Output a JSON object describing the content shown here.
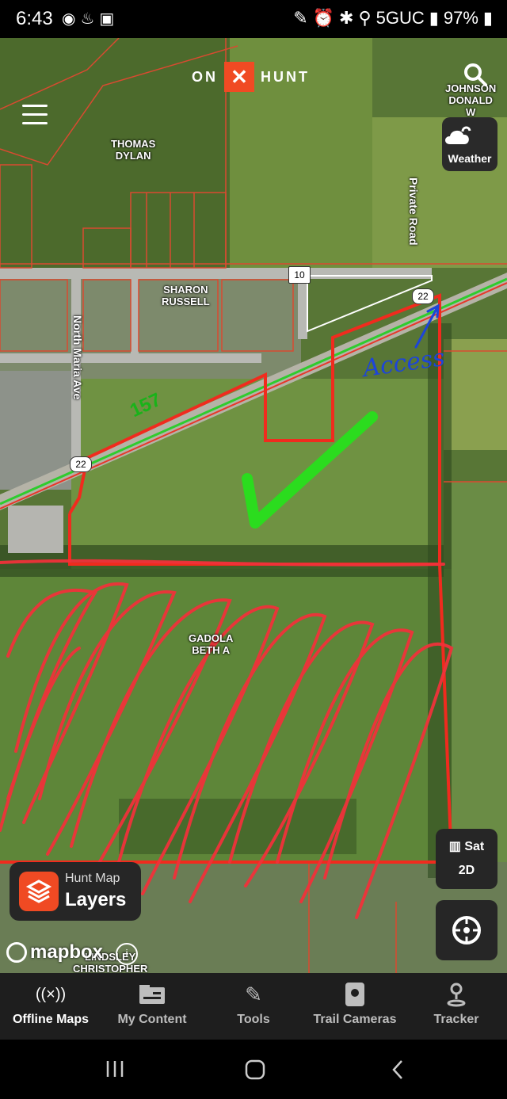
{
  "status": {
    "time": "6:43",
    "network": "5GUC",
    "battery": "97%",
    "left_icons": [
      "messenger-icon",
      "notification-icon",
      "gallery-icon"
    ],
    "right_icons": [
      "pen-icon",
      "alarm-icon",
      "bluetooth-icon",
      "location-icon",
      "signal-icon",
      "battery-icon"
    ]
  },
  "header": {
    "logo_left": "ON",
    "logo_mark": "✕",
    "logo_right": "HUNT"
  },
  "weather": {
    "label": "Weather"
  },
  "map_labels": {
    "owner_top_right": "JOHNSON\nDONALD\nW",
    "owner_thomas": "THOMAS\nDYLAN",
    "owner_sharon": "SHARON\nRUSSELL",
    "owner_gadola": "GADOLA\nBETH A",
    "owner_lindsley": "LINDSLEY\nCHRISTOPHER",
    "road_private": "Private Road",
    "road_maria": "North Maria Ave",
    "shield_10": "10",
    "shield_22a": "22",
    "shield_22b": "22",
    "route_157": "157",
    "access_note": "Access"
  },
  "layers": {
    "small": "Hunt Map",
    "big": "Layers"
  },
  "map_type": {
    "sat": "Sat",
    "mode": "2D"
  },
  "attribution": {
    "brand": "mapbox",
    "info": "i"
  },
  "nav": [
    {
      "label": "Offline Maps",
      "icon": "offline-maps-icon",
      "active": true
    },
    {
      "label": "My Content",
      "icon": "my-content-icon",
      "active": false
    },
    {
      "label": "Tools",
      "icon": "tools-icon",
      "active": false
    },
    {
      "label": "Trail Cameras",
      "icon": "trail-camera-icon",
      "active": false
    },
    {
      "label": "Tracker",
      "icon": "tracker-icon",
      "active": false
    }
  ],
  "colors": {
    "accent": "#f04a23",
    "boundary": "#e8362a",
    "check": "#2bdc1e",
    "access_ink": "#1d45d8"
  }
}
